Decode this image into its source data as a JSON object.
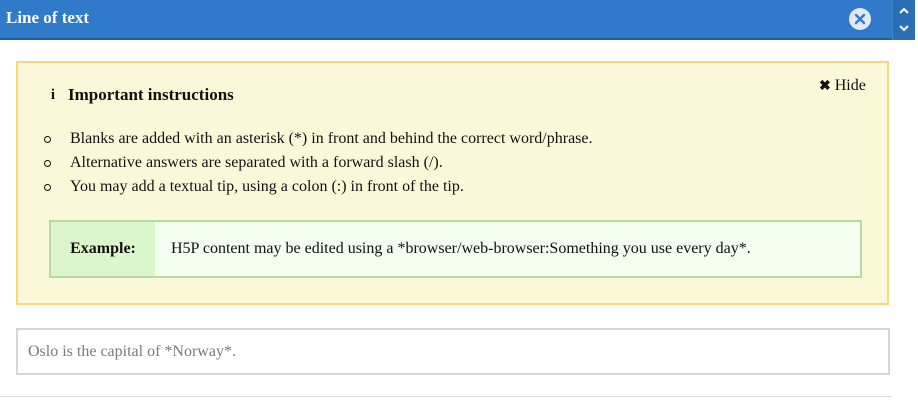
{
  "header": {
    "title": "Line of text",
    "bg_color": "#2f7bc9",
    "close_icon": "close-circle-icon",
    "scroll_up_icon": "chevron-up-icon",
    "scroll_down_icon": "chevron-down-icon"
  },
  "instructions": {
    "icon": "info-icon",
    "icon_glyph": "i",
    "title": "Important instructions",
    "hide_glyph": "✖",
    "hide_label": "Hide",
    "bg_color": "#fbf8d9",
    "border_color": "#f4d97c",
    "items": [
      "Blanks are added with an asterisk (*) in front and behind the correct word/phrase.",
      "Alternative answers are separated with a forward slash (/).",
      "You may add a textual tip, using a colon (:) in front of the tip."
    ],
    "example": {
      "label": "Example:",
      "text": "H5P content may be edited using a *browser/web-browser:Something you use every day*."
    }
  },
  "text_field": {
    "placeholder": "Oslo is the capital of *Norway*.",
    "value": ""
  }
}
